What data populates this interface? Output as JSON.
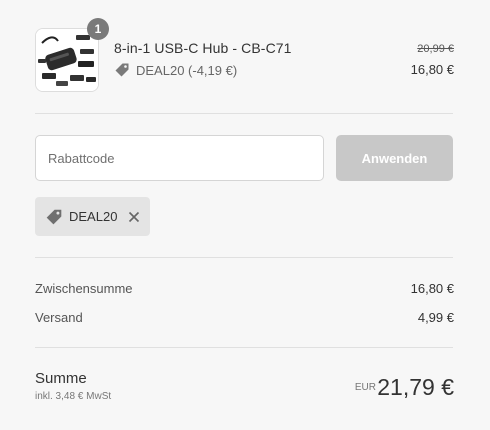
{
  "product": {
    "quantity": "1",
    "title": "8-in-1 USB-C Hub - CB-C71",
    "discount_text": "DEAL20 (-4,19 €)",
    "price_original": "20,99 €",
    "price_current": "16,80 €",
    "image_icon": "usb-hub-product-image"
  },
  "discount": {
    "placeholder": "Rabattcode",
    "apply_label": "Anwenden",
    "applied_code": "DEAL20"
  },
  "totals": {
    "subtotal_label": "Zwischensumme",
    "subtotal_value": "16,80 €",
    "shipping_label": "Versand",
    "shipping_value": "4,99 €",
    "sum_label": "Summe",
    "tax_note": "inkl. 3,48 € MwSt",
    "currency": "EUR",
    "total_value": "21,79 €"
  },
  "icons": {
    "tag": "tag-icon",
    "remove": "close-icon"
  },
  "colors": {
    "background": "#f7f7f7",
    "button_disabled": "#c8c8c8",
    "chip_bg": "#e4e4e4",
    "badge": "#7a7a7a"
  }
}
